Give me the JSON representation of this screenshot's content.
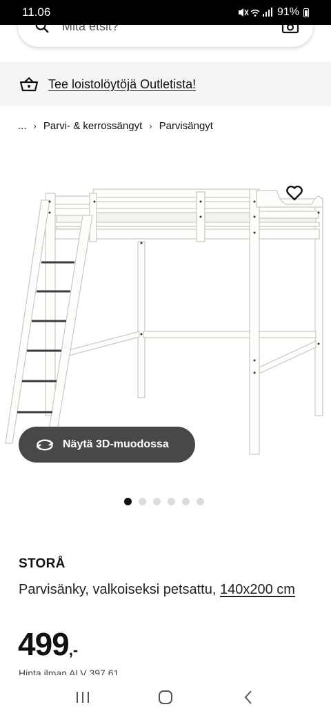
{
  "status_bar": {
    "time": "11.06",
    "battery": "91%"
  },
  "search": {
    "placeholder": "Mitä etsit?"
  },
  "outlet_banner": {
    "label": "Tee loistolöytöjä Outletista!"
  },
  "breadcrumb": {
    "items": [
      "...",
      "Parvi- & kerrossängyt",
      "Parvisängyt"
    ]
  },
  "gallery": {
    "view3d_label": "Näytä 3D-muodossa",
    "dot_count": 6,
    "active_dot": 0
  },
  "product": {
    "name": "STORÅ",
    "description": "Parvisänky, valkoiseksi petsattu, ",
    "size": "140x200 cm",
    "price_integer": "499",
    "price_decimal": ",-",
    "vat_text": "Hinta ilman ALV 397,61"
  },
  "colors": {
    "accent_dark": "#484848",
    "banner_bg": "#f5f5f5"
  },
  "icons": {
    "search": "search-icon",
    "camera": "camera-icon",
    "basket": "basket-icon",
    "favorite": "heart-icon",
    "view3d": "rotate-3d-icon"
  }
}
